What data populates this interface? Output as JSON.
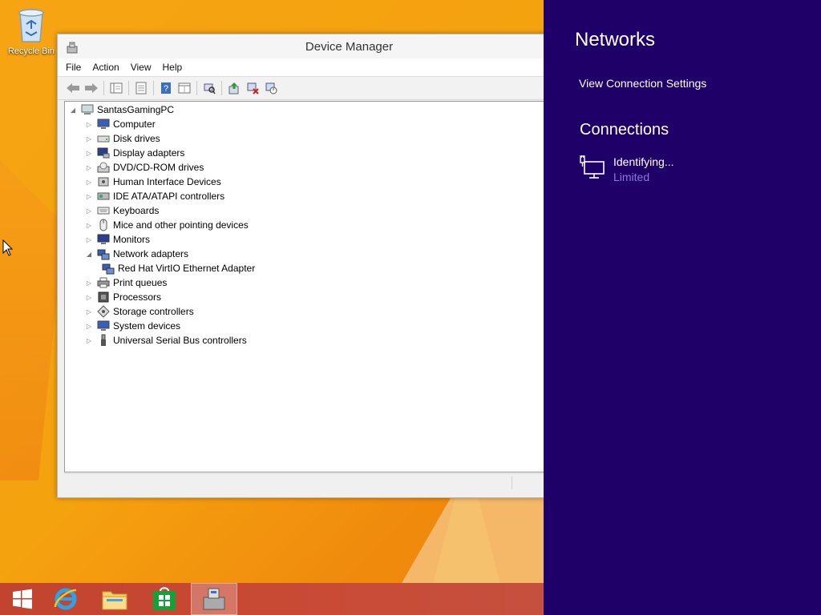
{
  "desktop": {
    "recycle_bin_label": "Recycle Bin"
  },
  "window": {
    "title": "Device Manager",
    "menu": [
      "File",
      "Action",
      "View",
      "Help"
    ],
    "toolbar_icons": [
      "back-arrow-icon",
      "forward-arrow-icon",
      "console-tree-icon",
      "properties-icon",
      "help-icon",
      "view-icon",
      "scan-hardware-icon",
      "update-driver-icon",
      "uninstall-icon",
      "disable-icon"
    ],
    "tree": {
      "root": "SantasGamingPC",
      "items": [
        {
          "label": "Computer",
          "expanded": false
        },
        {
          "label": "Disk drives",
          "expanded": false
        },
        {
          "label": "Display adapters",
          "expanded": false
        },
        {
          "label": "DVD/CD-ROM drives",
          "expanded": false
        },
        {
          "label": "Human Interface Devices",
          "expanded": false
        },
        {
          "label": "IDE ATA/ATAPI controllers",
          "expanded": false
        },
        {
          "label": "Keyboards",
          "expanded": false
        },
        {
          "label": "Mice and other pointing devices",
          "expanded": false
        },
        {
          "label": "Monitors",
          "expanded": false
        },
        {
          "label": "Network adapters",
          "expanded": true
        },
        {
          "label": "Red Hat VirtIO Ethernet Adapter",
          "child": true
        },
        {
          "label": "Print queues",
          "expanded": false
        },
        {
          "label": "Processors",
          "expanded": false
        },
        {
          "label": "Storage controllers",
          "expanded": false
        },
        {
          "label": "System devices",
          "expanded": false
        },
        {
          "label": "Universal Serial Bus controllers",
          "expanded": false
        }
      ]
    }
  },
  "taskbar": {
    "buttons": [
      "start-icon",
      "internet-explorer-icon",
      "file-explorer-icon",
      "store-icon",
      "device-manager-icon"
    ],
    "active": "device-manager-icon"
  },
  "networks": {
    "title": "Networks",
    "view_settings": "View Connection Settings",
    "connections_heading": "Connections",
    "connection_name": "Identifying...",
    "connection_status": "Limited"
  },
  "colors": {
    "charm_bg": "#1f0068",
    "desktop_bg": "#f5a20f",
    "taskbar_bg": "#c5473a",
    "limited_text": "#8b78d8"
  }
}
